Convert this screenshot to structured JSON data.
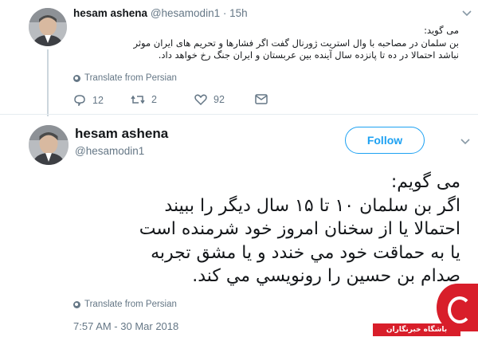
{
  "reply_tweet": {
    "name": "hesam ashena",
    "handle": "@hesamodin1",
    "time": "· 15h",
    "text_lines": [
      "می گوید:",
      "بن سلمان در مصاحبه با وال استریت ژورنال گفت اگر فشارها و تحریم های ایران موثر",
      "نباشد احتمالا در ده تا پانزده سال آینده بین عربستان و ایران جنگ رخ خواهد داد."
    ],
    "translate_label": "Translate from Persian",
    "actions": {
      "reply_count": "12",
      "retweet_count": "2",
      "like_count": "92"
    }
  },
  "main_tweet": {
    "name": "hesam ashena",
    "handle": "@hesamodin1",
    "follow_label": "Follow",
    "text_lines": [
      "می گویم:",
      "اگر بن سلمان ۱۰ تا ۱۵ سال دیگر را ببیند",
      "احتمالا یا از سخنان امروز خود شرمنده  است",
      "یا به حماقت خود مي خندد و یا  مشق تجربه",
      "صدام بن حسین را رونویسي مي کند."
    ],
    "translate_label": "Translate from Persian",
    "timestamp": "7:57 AM - 30 Mar 2018"
  },
  "watermark": {
    "text": "باشگاه خبرنگاران"
  },
  "colors": {
    "accent": "#1da1f2",
    "secondary_text": "#657786",
    "primary_text": "#14171a",
    "divider": "#e6ecf0",
    "watermark_red": "#d81e2a"
  },
  "icons": [
    "chevron-down-icon",
    "globe-icon",
    "reply-icon",
    "retweet-icon",
    "like-icon",
    "direct-message-icon"
  ]
}
